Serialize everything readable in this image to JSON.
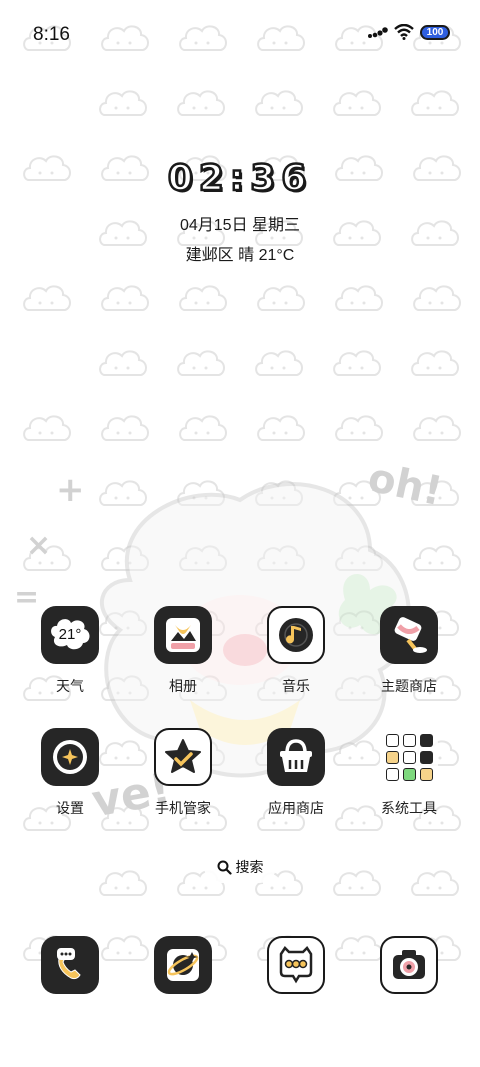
{
  "status_bar": {
    "time": "8:16",
    "battery": "100",
    "icons": [
      "signal-icon",
      "wifi-icon",
      "battery-icon"
    ]
  },
  "clock_widget": {
    "time": "02:36",
    "date": "04月15日 星期三",
    "weather": "建邺区 晴 21°C"
  },
  "apps": [
    {
      "label": "天气",
      "icon": "weather-icon",
      "badge": "21°"
    },
    {
      "label": "相册",
      "icon": "gallery-icon"
    },
    {
      "label": "音乐",
      "icon": "music-icon"
    },
    {
      "label": "主题商店",
      "icon": "theme-store-icon"
    },
    {
      "label": "设置",
      "icon": "settings-icon"
    },
    {
      "label": "手机管家",
      "icon": "phone-manager-icon"
    },
    {
      "label": "应用商店",
      "icon": "app-store-icon"
    },
    {
      "label": "系统工具",
      "icon": "system-tools-folder-icon"
    }
  ],
  "search": {
    "label": "搜索"
  },
  "dock": [
    {
      "icon": "phone-icon"
    },
    {
      "icon": "browser-icon"
    },
    {
      "icon": "messages-icon"
    },
    {
      "icon": "camera-icon"
    }
  ],
  "wallpaper": {
    "decor_text": [
      "oh!",
      "ve!"
    ]
  },
  "colors": {
    "accent": "#f6c45b",
    "icon_dark": "#262626",
    "battery": "#2f5fe0"
  }
}
